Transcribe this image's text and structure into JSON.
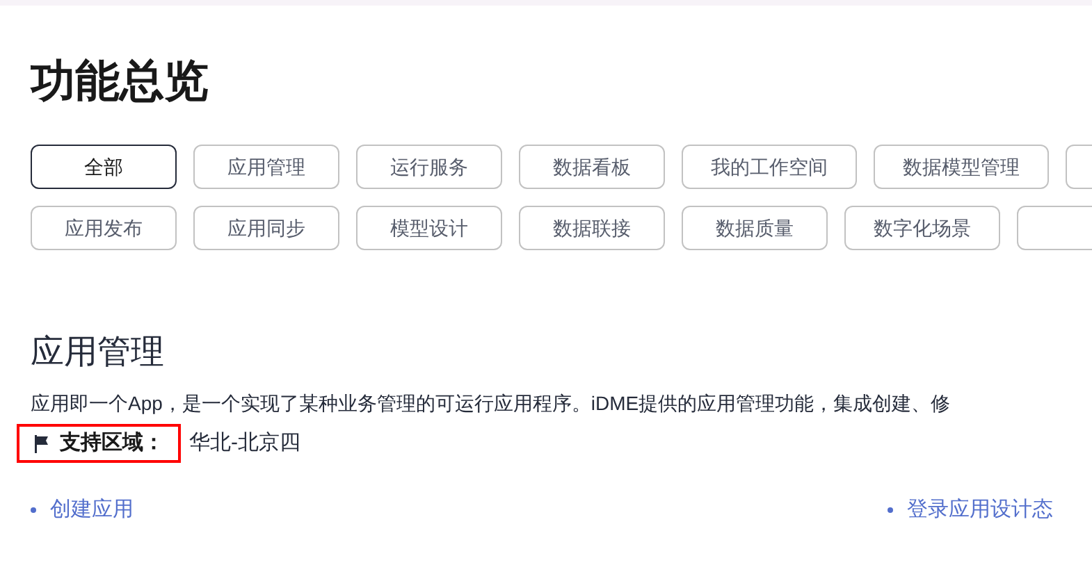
{
  "page_title": "功能总览",
  "filter_rows": [
    [
      {
        "label": "全部",
        "selected": true
      },
      {
        "label": "应用管理",
        "selected": false
      },
      {
        "label": "运行服务",
        "selected": false
      },
      {
        "label": "数据看板",
        "selected": false
      },
      {
        "label": "我的工作空间",
        "selected": false
      },
      {
        "label": "数据模型管理",
        "selected": false
      },
      {
        "selected": false
      }
    ],
    [
      {
        "label": "应用发布",
        "selected": false
      },
      {
        "label": "应用同步",
        "selected": false
      },
      {
        "label": "模型设计",
        "selected": false
      },
      {
        "label": "数据联接",
        "selected": false
      },
      {
        "label": "数据质量",
        "selected": false
      },
      {
        "label": "数字化场景",
        "selected": false
      },
      {
        "selected": false
      }
    ]
  ],
  "section": {
    "title": "应用管理",
    "description": "应用即一个App，是一个实现了某种业务管理的可运行应用程序。iDME提供的应用管理功能，集成创建、修",
    "region_label": "支持区域：",
    "region_value": "华北-北京四",
    "highlighted": true,
    "links": [
      "创建应用",
      "登录应用设计态"
    ]
  }
}
